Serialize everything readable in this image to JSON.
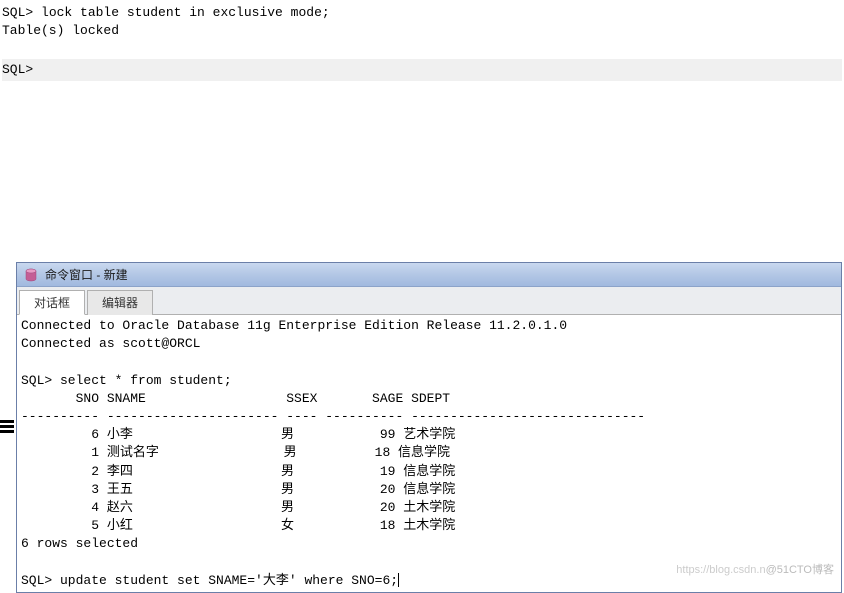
{
  "top_terminal": {
    "line1_prompt": "SQL>",
    "line1_cmd": " lock table student in exclusive mode;",
    "line2": "Table(s) locked",
    "line3_prompt": "SQL>"
  },
  "window": {
    "title": "命令窗口 - 新建",
    "tabs": {
      "dialog": "对话框",
      "editor": "编辑器"
    },
    "content": {
      "connected1": "Connected to Oracle Database 11g Enterprise Edition Release 11.2.0.1.0",
      "connected2": "Connected as scott@ORCL",
      "blank1": "",
      "select_prompt": "SQL> select * from student;",
      "header": "       SNO SNAME                  SSEX       SAGE SDEPT",
      "divider": "---------- ---------------------- ---- ---------- ------------------------------",
      "row1": "         6 小李                   男           99 艺术学院",
      "row2": "         1 测试名字                男          18 信息学院",
      "row3": "         2 李四                   男           19 信息学院",
      "row4": "         3 王五                   男           20 信息学院",
      "row5": "         4 赵六                   男           20 土木学院",
      "row6": "         5 小红                   女           18 土木学院",
      "rows_selected": "6 rows selected",
      "blank2": "",
      "update_line": "SQL> update student set SNAME='大李' where SNO=6;"
    }
  },
  "chart_data": {
    "type": "table",
    "title": "student",
    "columns": [
      "SNO",
      "SNAME",
      "SSEX",
      "SAGE",
      "SDEPT"
    ],
    "rows": [
      {
        "SNO": 6,
        "SNAME": "小李",
        "SSEX": "男",
        "SAGE": 99,
        "SDEPT": "艺术学院"
      },
      {
        "SNO": 1,
        "SNAME": "测试名字",
        "SSEX": "男",
        "SAGE": 18,
        "SDEPT": "信息学院"
      },
      {
        "SNO": 2,
        "SNAME": "李四",
        "SSEX": "男",
        "SAGE": 19,
        "SDEPT": "信息学院"
      },
      {
        "SNO": 3,
        "SNAME": "王五",
        "SSEX": "男",
        "SAGE": 20,
        "SDEPT": "信息学院"
      },
      {
        "SNO": 4,
        "SNAME": "赵六",
        "SSEX": "男",
        "SAGE": 20,
        "SDEPT": "土木学院"
      },
      {
        "SNO": 5,
        "SNAME": "小红",
        "SSEX": "女",
        "SAGE": 18,
        "SDEPT": "土木学院"
      }
    ]
  },
  "watermark": {
    "faded": "https://blog.csdn.n",
    "bold": "@51CTO博客"
  }
}
